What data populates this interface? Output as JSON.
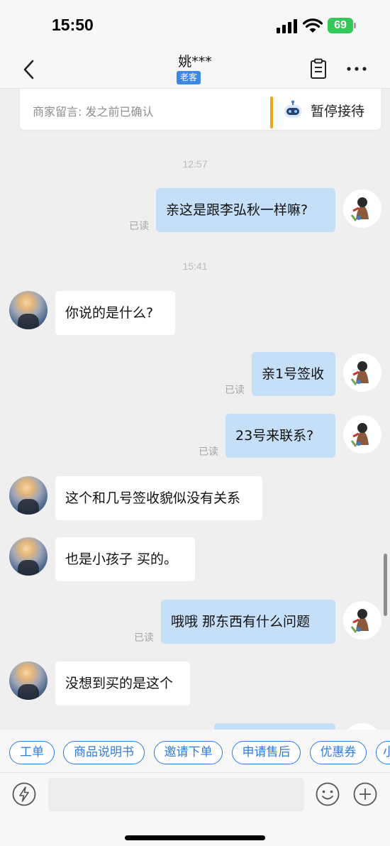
{
  "status_bar": {
    "time": "15:50",
    "battery": "69"
  },
  "header": {
    "title": "姚***",
    "badge": "老客"
  },
  "note": {
    "text": "商家留言: 发之前已确认",
    "pause_label": "暂停接待"
  },
  "timestamps": [
    "12:57",
    "15:41"
  ],
  "messages": [
    {
      "side": "out",
      "text": "亲这是跟李弘秋一样嘛?",
      "status": "已读"
    },
    {
      "side": "in",
      "text": "你说的是什么?"
    },
    {
      "side": "out",
      "text": "亲1号签收",
      "status": "已读"
    },
    {
      "side": "out",
      "text": "23号来联系?",
      "status": "已读"
    },
    {
      "side": "in",
      "text": "这个和几号签收貌似没有关系"
    },
    {
      "side": "in",
      "text": "也是小孩子 买的。"
    },
    {
      "side": "out",
      "text": "哦哦   那东西有什么问题",
      "status": "已读"
    },
    {
      "side": "in",
      "text": "没想到买的是这个"
    }
  ],
  "quick_replies": [
    "工单",
    "商品说明书",
    "邀请下单",
    "申请售后",
    "优惠券",
    "小"
  ],
  "input": {
    "placeholder": ""
  },
  "colors": {
    "accent": "#2f7bde",
    "outgoing_bubble": "#c6dff8",
    "battery": "#34c759",
    "note_bar": "#f0a51c"
  }
}
